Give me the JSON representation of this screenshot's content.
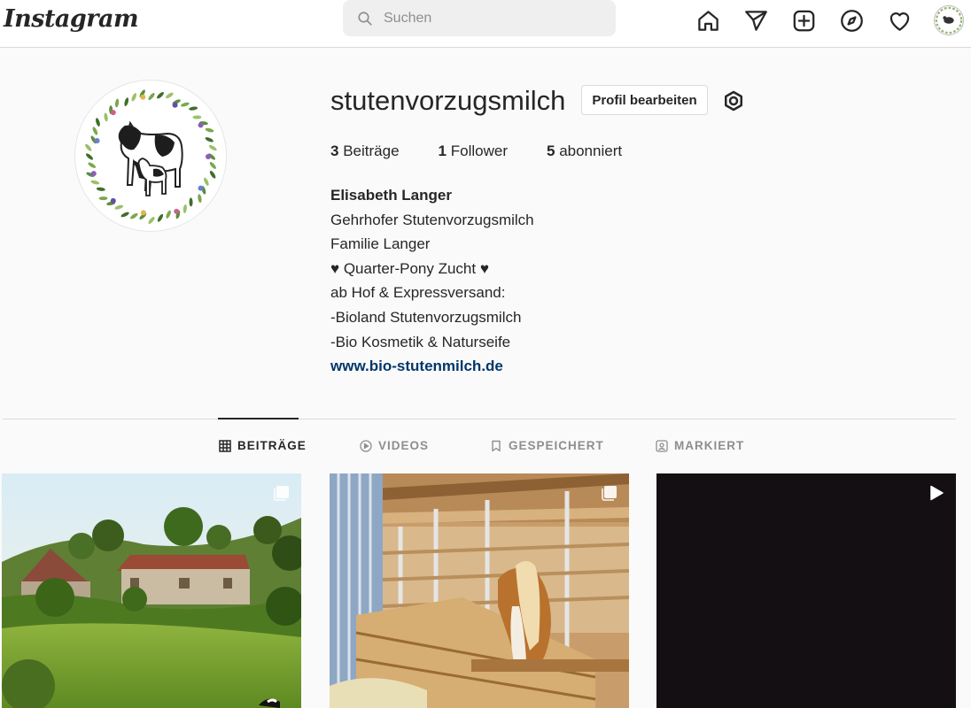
{
  "nav": {
    "logo": "Instagram",
    "search_placeholder": "Suchen",
    "icons": [
      "home-icon",
      "direct-icon",
      "new-post-icon",
      "explore-icon",
      "activity-icon",
      "profile-avatar"
    ]
  },
  "profile": {
    "username": "stutenvorzugsmilch",
    "edit_label": "Profil bearbeiten",
    "stats": {
      "posts_count": "3",
      "posts_label": "Beiträge",
      "followers_count": "1",
      "followers_label": "Follower",
      "following_count": "5",
      "following_label": "abonniert"
    },
    "bio": {
      "name": "Elisabeth Langer",
      "lines": [
        "Gehrhofer Stutenvorzugsmilch",
        "Familie Langer",
        "♥ Quarter-Pony Zucht ♥",
        "ab Hof & Expressversand:",
        "-Bioland Stutenvorzugsmilch",
        "-Bio Kosmetik & Naturseife"
      ],
      "link": "www.bio-stutenmilch.de"
    }
  },
  "tabs": [
    {
      "label": "BEITRÄGE",
      "active": true
    },
    {
      "label": "VIDEOS",
      "active": false
    },
    {
      "label": "GESPEICHERT",
      "active": false
    },
    {
      "label": "MARKIERT",
      "active": false
    }
  ],
  "posts": [
    {
      "type": "carousel"
    },
    {
      "type": "carousel"
    },
    {
      "type": "video"
    }
  ],
  "colors": {
    "link": "#00376b",
    "text": "#262626",
    "muted": "#8e8e8e",
    "border": "#dbdbdb"
  }
}
